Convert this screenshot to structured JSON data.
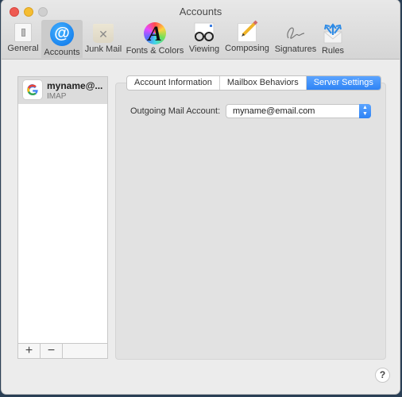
{
  "window": {
    "title": "Accounts"
  },
  "toolbar": {
    "items": [
      {
        "label": "General",
        "icon": "general-switch-icon"
      },
      {
        "label": "Accounts",
        "icon": "at-sign-icon",
        "selected": true
      },
      {
        "label": "Junk Mail",
        "icon": "junk-bin-icon"
      },
      {
        "label": "Fonts & Colors",
        "icon": "font-color-wheel-icon"
      },
      {
        "label": "Viewing",
        "icon": "glasses-icon"
      },
      {
        "label": "Composing",
        "icon": "pencil-paper-icon"
      },
      {
        "label": "Signatures",
        "icon": "signature-icon"
      },
      {
        "label": "Rules",
        "icon": "rules-envelope-icon"
      }
    ],
    "glyphs": {
      "at": "@",
      "junk": "✕",
      "fonts": "A"
    }
  },
  "accounts": [
    {
      "name": "myname@...",
      "type": "IMAP",
      "provider_glyph": "G",
      "selected": true
    }
  ],
  "list_footer": {
    "add": "+",
    "remove": "−"
  },
  "tabs": [
    {
      "label": "Account Information"
    },
    {
      "label": "Mailbox Behaviors"
    },
    {
      "label": "Server Settings",
      "active": true
    }
  ],
  "server_settings": {
    "outgoing_label": "Outgoing Mail Account:",
    "outgoing_value": "myname@email.com",
    "popup_arrows": "▲▼"
  },
  "help": {
    "glyph": "?"
  },
  "colors": {
    "accent": "#2e83f5",
    "close": "#ee5a52",
    "minimize": "#f5bd31"
  }
}
